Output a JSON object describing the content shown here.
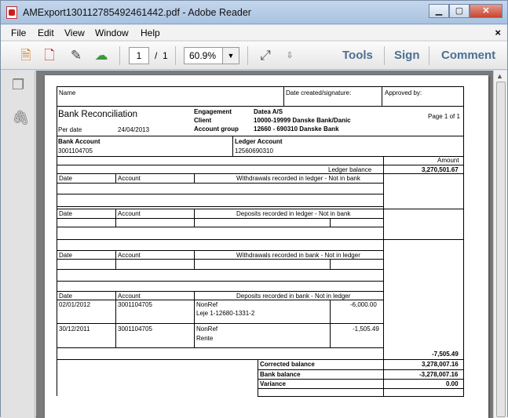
{
  "window": {
    "title": "AMExport130112785492461442.pdf - Adobe Reader",
    "min": "▁",
    "max": "▢",
    "close": "✕"
  },
  "menu": {
    "file": "File",
    "edit": "Edit",
    "view": "View",
    "window": "Window",
    "help": "Help",
    "close": "×"
  },
  "toolbar": {
    "page_current": "1",
    "page_sep": "/",
    "page_total": "1",
    "zoom": "60.9%",
    "zoom_arrow": "▼",
    "more_arrow": "⇩",
    "tools": "Tools",
    "sign": "Sign",
    "comment": "Comment"
  },
  "doc": {
    "hdr_name": "Name",
    "hdr_date": "Date created/signature:",
    "hdr_approved": "Approved by:",
    "title": "Bank Reconciliation",
    "per_date_label": "Per date",
    "per_date": "24/04/2013",
    "engagement_label": "Engagement",
    "engagement": "Datea A/S",
    "client_label": "Client",
    "client": "10000-19999 Danske Bank/Danic",
    "account_group_label": "Account group",
    "account_group": "12660 - 690310 Danske Bank",
    "page": "Page 1 of 1",
    "bank_account_label": "Bank Account",
    "bank_account": "3001104705",
    "ledger_account_label": "Ledger Account",
    "ledger_account": "12560690310",
    "amount_label": "Amount",
    "ledger_balance_label": "Ledger balance",
    "ledger_balance": "3,270,501.67",
    "col_date": "Date",
    "col_account": "Account",
    "s1_title": "Withdrawals recorded in ledger - Not in bank",
    "s2_title": "Deposits recorded in ledger - Not in bank",
    "s3_title": "Withdrawals recorded in bank - Not in ledger",
    "s4_title": "Deposits recorded in bank  - Not in ledger",
    "rows": [
      {
        "date": "02/01/2012",
        "account": "3001104705",
        "text1": "NonRef",
        "text2": "Leje 1-12680-1331-2",
        "amount": "-6,000.00"
      },
      {
        "date": "30/12/2011",
        "account": "3001104705",
        "text1": "NonRef",
        "text2": "Rente",
        "amount": "-1,505.49"
      }
    ],
    "s4_total": "-7,505.49",
    "corrected_label": "Corrected balance",
    "corrected": "3,278,007.16",
    "bank_balance_label": "Bank balance",
    "bank_balance": "-3,278,007.16",
    "variance_label": "Variance",
    "variance": "0.00"
  }
}
